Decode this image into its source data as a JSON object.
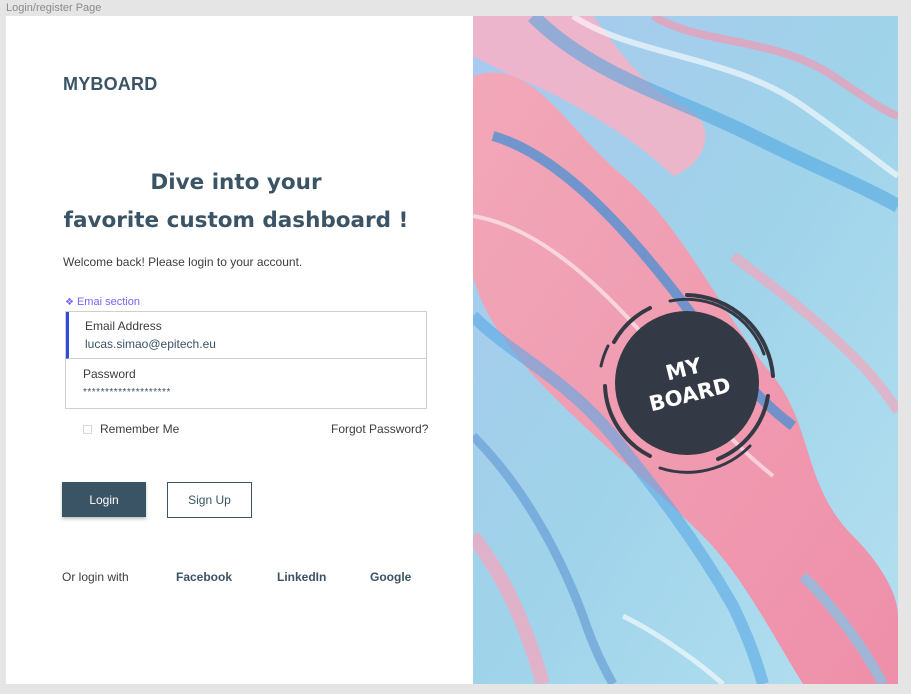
{
  "frame": {
    "label": "Login/register Page"
  },
  "brand": {
    "name": "MYBOARD"
  },
  "hero": {
    "line1": "Dive into your",
    "line2": "favorite custom dashboard !"
  },
  "welcome": "Welcome  back! Please login to your account.",
  "section_tag": "Emai section",
  "form": {
    "email": {
      "label": "Email Address",
      "value": "lucas.simao@epitech.eu"
    },
    "password": {
      "label": "Password",
      "value": "********************"
    },
    "remember_label": "Remember Me",
    "forgot_label": "Forgot Password?"
  },
  "buttons": {
    "login": "Login",
    "signup": "Sign Up"
  },
  "social": {
    "prompt": "Or login with",
    "facebook": "Facebook",
    "linkedin": "LinkedIn",
    "google": "Google"
  },
  "logo": {
    "line1": "MY",
    "line2": "BOARD"
  },
  "colors": {
    "primary": "#3a5365",
    "focus": "#2f4bd9",
    "section_tag": "#7b61ff",
    "logo_fill": "#343a45"
  }
}
